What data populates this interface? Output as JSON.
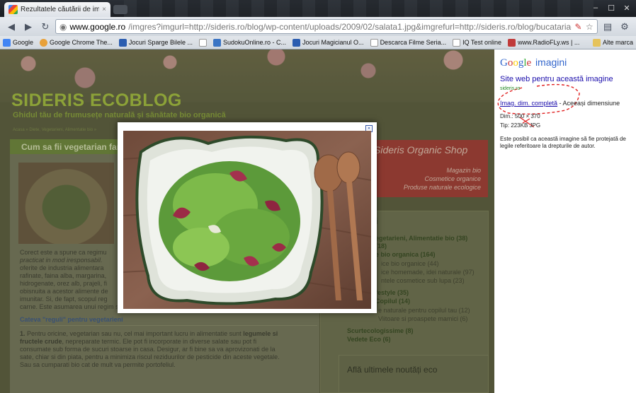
{
  "browser": {
    "tab_title": "Rezultatele căutării de im...",
    "tab_close": "×",
    "url_domain": "www.google.ro",
    "url_rest": "/imgres?imgurl=http://sideris.ro/blog/wp-content/uploads/2009/02/salata1.jpg&imgrefurl=http://sideris.ro/blog/bucataria-organica/cum-sa-fii-veg",
    "win_min": "–",
    "win_max": "☐",
    "win_close": "✕"
  },
  "bookmarks": [
    {
      "label": "Google",
      "color": "#4285f4"
    },
    {
      "label": "Google Chrome The...",
      "color": "#e8a13a"
    },
    {
      "label": "Jocuri Sparge Bilele ...",
      "color": "#2b5db0"
    },
    {
      "label": "",
      "color": "#ffffff"
    },
    {
      "label": "SudokuOnline.ro - C...",
      "color": "#3a74c4"
    },
    {
      "label": "Jocuri Magicianul O...",
      "color": "#2b5db0"
    },
    {
      "label": "Descarca Filme Seria...",
      "color": "#ffffff"
    },
    {
      "label": "IQ Test online",
      "color": "#ffffff"
    },
    {
      "label": "www.RadioFLy.ws | ...",
      "color": "#c03a3a"
    }
  ],
  "bookmarks_other": "Alte marca",
  "blog": {
    "title": "SIDERIS ECOBLOG",
    "tagline": "Ghidul tău de frumusețe naturală și sănătate bio organică",
    "breadcrumb": "Acasa » Diete, Vegetarieni, Alimentatie bio »",
    "post_title": "Cum sa fii vegetarian far",
    "para1_l1": "Corect este a spune ca regimu",
    "para1_l2": "practicat in mod iresponsabil.",
    "para1_l3": "oferite de industria alimentara",
    "para1_l4": "rafinate, faina alba, margarina,",
    "para1_l5": "hidrogenate, orez alb, prajeli, fi",
    "para1_l6": "obisnuita a acestor alimente de",
    "para1_l7": "imunitar. Si, de fapt, scopul reg",
    "para1_l8": "carne. Este asumarea unui regim sanatos, energizant, chiozuit.",
    "section_title": "Cateva \"reguli\" pentru vegetarieni",
    "rule_l1a": "1.",
    "rule_l1b": "Pentru oricine, vegetarian sau nu, cel mai important lucru in alimentatie sunt",
    "rule_l1c": "legumele si",
    "rule_l2a": "fructele crude",
    "rule_l2b": ", nepreparate termic. Ele pot fi incorporate in diverse salate sau pot fi",
    "rule_l3": "consumate sub forma de sucuri stoarse in casa. Desigur, ar fi bine sa va aprovizonati de la",
    "rule_l4": "sate, chiar si din piata, pentru a minimiza riscul reziduurilor de pesticide din aceste vegetale.",
    "rule_l5": "Sau sa cumparati bio cat de mult va permite portofeliul.",
    "shop_name": "Sideris Organic Shop",
    "shop_l1": "Magazin bio",
    "shop_l2": "Cosmetice organice",
    "shop_l3": "Produse naturale ecologice",
    "sidebar_title": "rii",
    "categories": [
      {
        "text": "egetarieni, Alimentatie bio (38)",
        "bold": true
      },
      {
        "text": "(18)",
        "bold": true
      },
      {
        "text": "e bio organica (164)",
        "bold": true
      },
      {
        "text": "ice bio organice (44)",
        "bold": false
      },
      {
        "text": "ice homemade, idei naturale (97)",
        "bold": false
      },
      {
        "text": "ntele cosmetice sub lupa (23)",
        "bold": false
      },
      {
        "text": "festyle (35)",
        "bold": true
      },
      {
        "text": "Copilul (14)",
        "bold": true
      },
      {
        "text": "e naturale pentru copilul tau (12)",
        "bold": false
      },
      {
        "text": "Viitoare si proaspete mamici (6)",
        "bold": false
      },
      {
        "text": "Scurtecologissime (8)",
        "bold": true
      },
      {
        "text": "Vedete Eco (6)",
        "bold": true
      }
    ],
    "news_title": "Află ultimele noutăți eco"
  },
  "lightbox": {
    "close": "×"
  },
  "gpanel": {
    "logo_g1": "G",
    "logo_o1": "o",
    "logo_o2": "o",
    "logo_g2": "g",
    "logo_l": "l",
    "logo_e": "e",
    "logo_word": "imagini",
    "site_link": "Site web pentru această imagine",
    "host": "sideris.ro",
    "full_link": "Imag. dim. completă",
    "full_sep": " - ",
    "full_rest": "Aceeași dimensiune",
    "dim": "Dim.: 500 × 370",
    "type": "Tip:   223KB JPG",
    "note": "Este posibil ca această imagine să fie protejată de legile referitoare la drepturile de autor."
  }
}
